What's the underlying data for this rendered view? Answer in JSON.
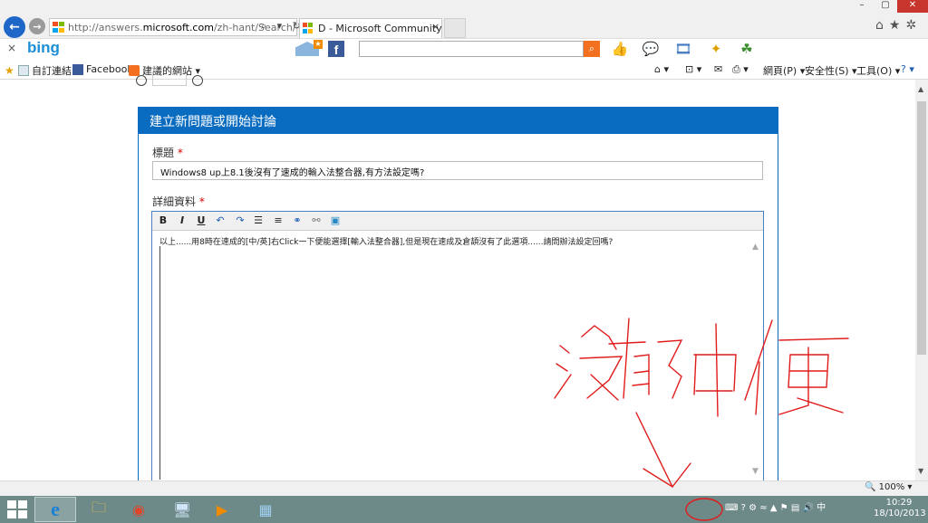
{
  "window": {
    "minimize_label": "–",
    "maximize_label": "▢",
    "close_label": "✕"
  },
  "browser": {
    "back_label": "←",
    "forward_label": "→",
    "address_prefix": "http://answers.",
    "address_domain": "microsoft.com",
    "address_suffix": "/zh-hant/Search/Sear",
    "address_tools": "⌕ ▾ ↻",
    "tab_title": "D - Microsoft Community",
    "tab_close": "×",
    "right_tools": "⌂★✲"
  },
  "bingbar": {
    "close_label": "×",
    "logo": "bing",
    "fb_label": "f",
    "search_value": "",
    "go_label": "⌕",
    "icons": [
      "thumbs-up-icon",
      "chat-icon",
      "video-icon",
      "sparkle-icon",
      "people-icon"
    ]
  },
  "favorites": {
    "items": [
      {
        "label": "自訂連結"
      },
      {
        "label": "Facebook"
      },
      {
        "label": "建議的網站 ▾"
      }
    ],
    "commands": {
      "home": "⌂ ▾",
      "feeds": "⊡ ▾",
      "mail": "✉",
      "print": "⎙ ▾",
      "page": "網頁(P) ▾",
      "safety": "安全性(S) ▾",
      "tools": "工具(O) ▾",
      "help": "? ▾"
    }
  },
  "form": {
    "heading": "建立新問題或開始討論",
    "title_label": "標題",
    "title_required": "*",
    "title_value": "Windows8 up上8.1後沒有了速成的輸入法整合器,有方法設定嗎?",
    "details_label": "詳細資料",
    "details_required": "*",
    "toolbar": {
      "bold": "B",
      "italic": "I",
      "underline": "U",
      "undo": "↶",
      "redo": "↷",
      "bullets": "☰",
      "numbers": "≡",
      "link": "⚭",
      "unlink": "⚯",
      "image": "▣"
    },
    "body_text": "以上......用8時在速成的[中/英]右Click一下便能選擇[輸入法整合器],但是現在速成及倉頡沒有了此選項......請問辦法設定回嗎?"
  },
  "status": {
    "zoom": "🔍 100%  ▾"
  },
  "taskbar": {
    "apps": [
      {
        "name": "ie",
        "glyph": "e"
      },
      {
        "name": "explorer",
        "glyph": "🗀"
      },
      {
        "name": "chrome",
        "glyph": "◉"
      },
      {
        "name": "computer",
        "glyph": "🖥"
      },
      {
        "name": "media",
        "glyph": "▶"
      },
      {
        "name": "remote",
        "glyph": "▦"
      }
    ],
    "tray_text": "⌨ ? ⚙ ≈ ▲ ⚑ ▤ 🔊 中",
    "time": "10:29",
    "date": "18/10/2013"
  }
}
